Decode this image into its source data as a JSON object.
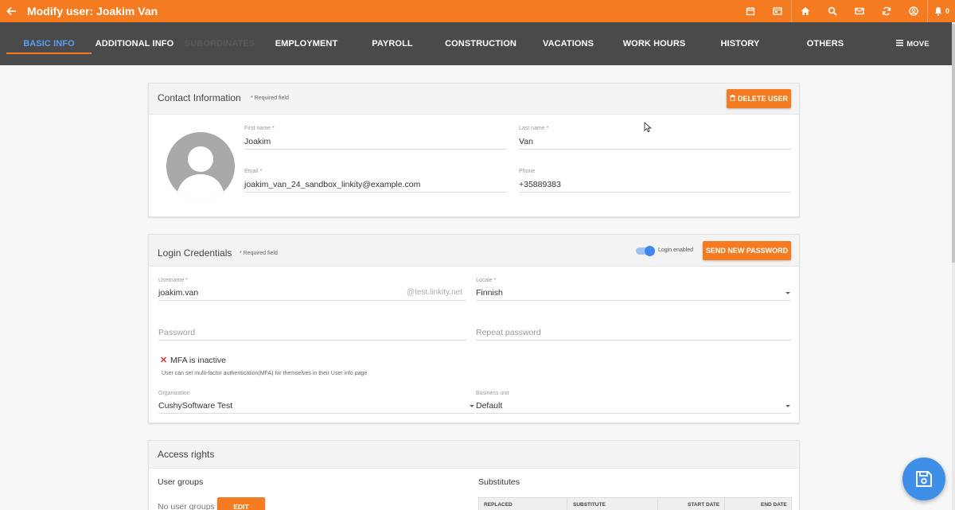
{
  "topbar": {
    "title": "Modify user: Joakim Van",
    "notification_count": "0",
    "icons": [
      "calendar-icon",
      "window-icon",
      "home-icon",
      "search-icon",
      "mail-icon",
      "sync-icon",
      "user-circle-icon",
      "bell-icon"
    ]
  },
  "nav": {
    "tabs": [
      {
        "label": "BASIC INFO"
      },
      {
        "label": "ADDITIONAL INFO"
      },
      {
        "label": "SUBORDINATES"
      },
      {
        "label": "EMPLOYMENT"
      },
      {
        "label": "PAYROLL"
      },
      {
        "label": "CONSTRUCTION"
      },
      {
        "label": "VACATIONS"
      },
      {
        "label": "WORK HOURS"
      },
      {
        "label": "HISTORY"
      },
      {
        "label": "OTHERS"
      }
    ],
    "move_label": "MOVE"
  },
  "contact": {
    "title": "Contact Information",
    "required_note": "* Required field",
    "delete_label": "DELETE USER",
    "first_name_label": "First name *",
    "first_name": "Joakim",
    "last_name_label": "Last name *",
    "last_name": "Van",
    "email_label": "Email *",
    "email": "joakim_van_24_sandbox_linkity@example.com",
    "phone_label": "Phone",
    "phone": "+35889383"
  },
  "login": {
    "title": "Login Credentials",
    "required_note": "* Required field",
    "login_enabled_label": "Login enabled",
    "send_password_label": "SEND NEW PASSWORD",
    "username_label": "Username *",
    "username": "joakim.van",
    "domain_suffix": "@test.linkity.net",
    "locale_label": "Locale *",
    "locale": "Finnish",
    "password_placeholder": "Password",
    "repeat_password_placeholder": "Repeat password",
    "mfa_status": "MFA is inactive",
    "mfa_help": "User can set multi-factor authentication(MFA) for themselves in their User info page",
    "organization_label": "Organization",
    "organization": "CushySoftware Test",
    "business_unit_label": "Business unit",
    "business_unit": "Default"
  },
  "access": {
    "title": "Access rights",
    "user_groups_label": "User groups",
    "no_user_groups": "No user groups",
    "edit_label": "EDIT",
    "substitutes_label": "Substitutes",
    "columns": [
      "REPLACED",
      "SUBSTITUTE",
      "START DATE",
      "END DATE"
    ]
  },
  "colors": {
    "brand_orange": "#f47b20",
    "nav_dark": "#4a4a4a",
    "accent_blue": "#3f86f0"
  }
}
